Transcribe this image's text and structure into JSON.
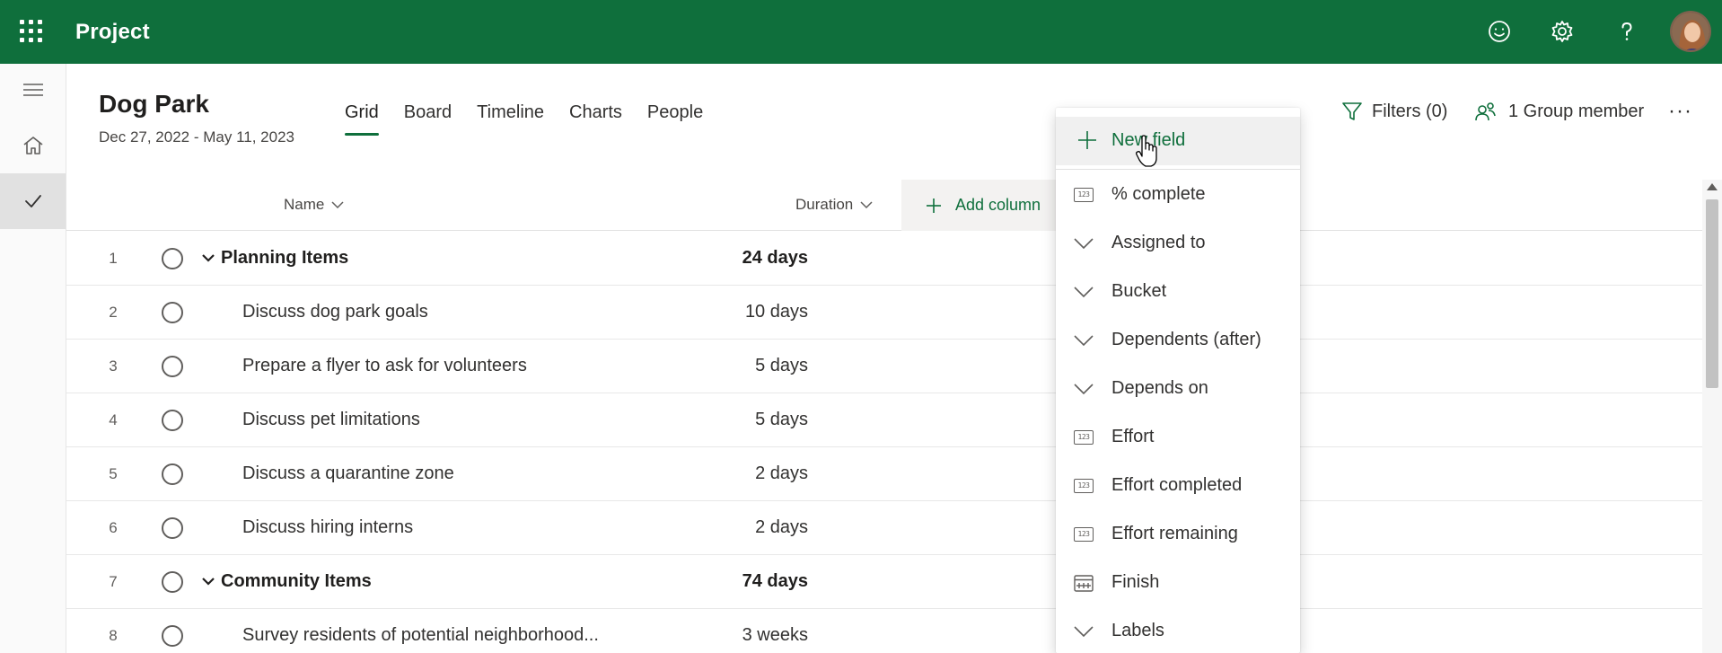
{
  "app": {
    "title": "Project",
    "brand_color": "#0f6f3c"
  },
  "header_icons": [
    {
      "name": "feedback-smiley-icon"
    },
    {
      "name": "settings-gear-icon"
    },
    {
      "name": "help-question-icon"
    }
  ],
  "rail": {
    "items": [
      {
        "name": "menu-hamburger-icon"
      },
      {
        "name": "home-icon"
      },
      {
        "name": "checkmark-tasks-icon",
        "active": true
      }
    ]
  },
  "project": {
    "title": "Dog Park",
    "dates": "Dec 27, 2022 - May 11, 2023"
  },
  "tabs": [
    {
      "label": "Grid",
      "active": true
    },
    {
      "label": "Board"
    },
    {
      "label": "Timeline"
    },
    {
      "label": "Charts"
    },
    {
      "label": "People"
    }
  ],
  "toolbar": {
    "filters_label": "Filters (0)",
    "members_label": "1 Group member",
    "more_label": "···"
  },
  "grid": {
    "columns": {
      "name": "Name",
      "duration": "Duration",
      "add_column": "Add column"
    },
    "rows": [
      {
        "num": "1",
        "name": "Planning Items",
        "duration": "24 days",
        "group": true
      },
      {
        "num": "2",
        "name": "Discuss dog park goals",
        "duration": "10 days",
        "group": false
      },
      {
        "num": "3",
        "name": "Prepare a flyer to ask for volunteers",
        "duration": "5 days",
        "group": false
      },
      {
        "num": "4",
        "name": "Discuss pet limitations",
        "duration": "5 days",
        "group": false
      },
      {
        "num": "5",
        "name": "Discuss a quarantine zone",
        "duration": "2 days",
        "group": false
      },
      {
        "num": "6",
        "name": "Discuss hiring interns",
        "duration": "2 days",
        "group": false
      },
      {
        "num": "7",
        "name": "Community Items",
        "duration": "74 days",
        "group": true
      },
      {
        "num": "8",
        "name": "Survey residents of potential neighborhood...",
        "duration": "3 weeks",
        "group": false
      }
    ]
  },
  "dropdown": {
    "new_field": "New field",
    "items": [
      {
        "label": "% complete",
        "icon": "number-field-icon"
      },
      {
        "label": "Assigned to",
        "icon": "chevron-down-icon"
      },
      {
        "label": "Bucket",
        "icon": "chevron-down-icon"
      },
      {
        "label": "Dependents (after)",
        "icon": "chevron-down-icon"
      },
      {
        "label": "Depends on",
        "icon": "chevron-down-icon"
      },
      {
        "label": "Effort",
        "icon": "number-field-icon"
      },
      {
        "label": "Effort completed",
        "icon": "number-field-icon"
      },
      {
        "label": "Effort remaining",
        "icon": "number-field-icon"
      },
      {
        "label": "Finish",
        "icon": "calendar-icon"
      },
      {
        "label": "Labels",
        "icon": "chevron-down-icon"
      }
    ]
  }
}
